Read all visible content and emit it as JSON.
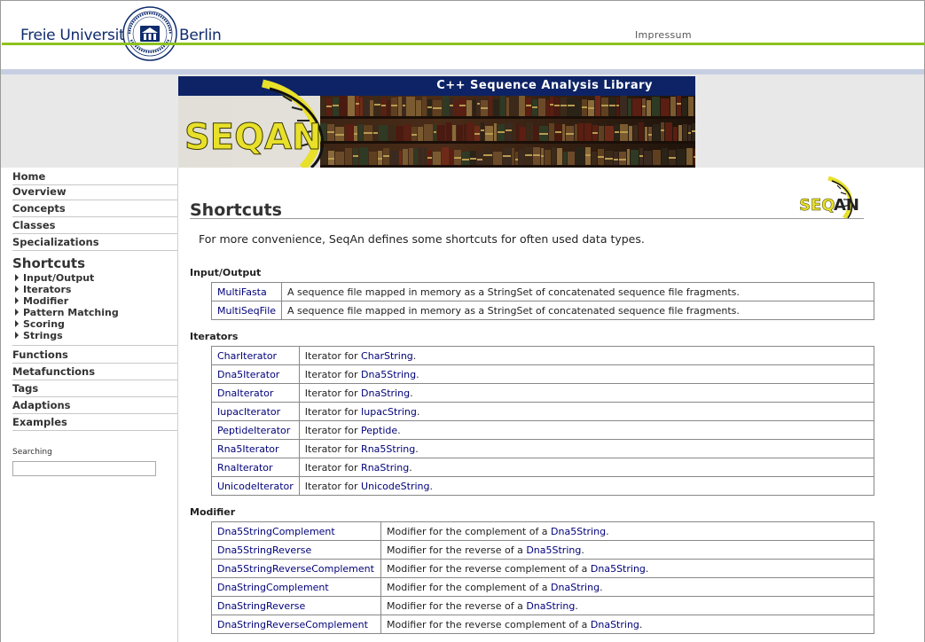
{
  "header": {
    "university_left": "Freie Universität",
    "university_right": "Berlin",
    "seal_text": "VERITAS JUSTITIA LIBERTAS · FREIE UNIVERSITÄT BERLIN",
    "impressum": "Impressum",
    "colors": {
      "green_line": "#8dc21f",
      "blue_line": "#c6cfe1",
      "brand_blue": "#0f2c6c"
    }
  },
  "banner": {
    "title": "C++ Sequence Analysis Library",
    "logo_text": "SEQAN",
    "colors": {
      "title_bar": "#0d2366",
      "logo_yellow": "#e8e02a"
    }
  },
  "sidebar": {
    "items_top": [
      "Home",
      "Overview",
      "Concepts",
      "Classes",
      "Specializations"
    ],
    "current": "Shortcuts",
    "subitems": [
      "Input/Output",
      "Iterators",
      "Modifier",
      "Pattern Matching",
      "Scoring",
      "Strings"
    ],
    "items_bottom": [
      "Functions",
      "Metafunctions",
      "Tags",
      "Adaptions",
      "Examples"
    ],
    "search_label": "Searching",
    "search_value": ""
  },
  "main": {
    "title": "Shortcuts",
    "intro": "For more convenience, SeqAn defines some shortcuts for often used data types.",
    "sections": [
      {
        "title": "Input/Output",
        "rows": [
          {
            "name": "MultiFasta",
            "desc": "A sequence file mapped in memory as a StringSet of concatenated sequence file fragments."
          },
          {
            "name": "MultiSeqFile",
            "desc": "A sequence file mapped in memory as a StringSet of concatenated sequence file fragments."
          }
        ]
      },
      {
        "title": "Iterators",
        "rows": [
          {
            "name": "CharIterator",
            "prefix": "Iterator for ",
            "link": "CharString",
            "suffix": "."
          },
          {
            "name": "Dna5Iterator",
            "prefix": "Iterator for ",
            "link": "Dna5String",
            "suffix": "."
          },
          {
            "name": "DnaIterator",
            "prefix": "Iterator for ",
            "link": "DnaString",
            "suffix": "."
          },
          {
            "name": "IupacIterator",
            "prefix": "Iterator for ",
            "link": "IupacString",
            "suffix": "."
          },
          {
            "name": "PeptideIterator",
            "prefix": "Iterator for ",
            "link": "Peptide",
            "suffix": "."
          },
          {
            "name": "Rna5Iterator",
            "prefix": "Iterator for ",
            "link": "Rna5String",
            "suffix": "."
          },
          {
            "name": "RnaIterator",
            "prefix": "Iterator for ",
            "link": "RnaString",
            "suffix": "."
          },
          {
            "name": "UnicodeIterator",
            "prefix": "Iterator for ",
            "link": "UnicodeString",
            "suffix": "."
          }
        ]
      },
      {
        "title": "Modifier",
        "rows": [
          {
            "name": "Dna5StringComplement",
            "prefix": "Modifier for the complement of a ",
            "link": "Dna5String",
            "suffix": "."
          },
          {
            "name": "Dna5StringReverse",
            "prefix": "Modifier for the reverse of a ",
            "link": "Dna5String",
            "suffix": "."
          },
          {
            "name": "Dna5StringReverseComplement",
            "prefix": "Modifier for the reverse complement of a ",
            "link": "Dna5String",
            "suffix": "."
          },
          {
            "name": "DnaStringComplement",
            "prefix": "Modifier for the complement of a ",
            "link": "DnaString",
            "suffix": "."
          },
          {
            "name": "DnaStringReverse",
            "prefix": "Modifier for the reverse of a ",
            "link": "DnaString",
            "suffix": "."
          },
          {
            "name": "DnaStringReverseComplement",
            "prefix": "Modifier for the reverse complement of a ",
            "link": "DnaString",
            "suffix": "."
          }
        ]
      }
    ]
  }
}
